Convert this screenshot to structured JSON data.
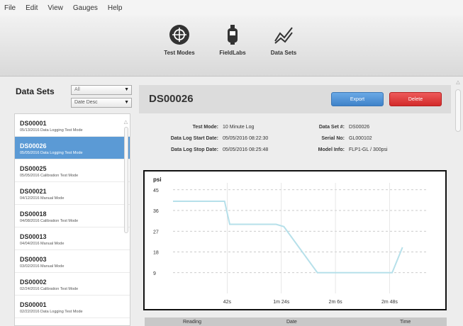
{
  "menu": [
    "File",
    "Edit",
    "View",
    "Gauges",
    "Help"
  ],
  "toolbar": {
    "test_modes": "Test Modes",
    "fieldlabs": "FieldLabs",
    "data_sets": "Data Sets"
  },
  "sidebar": {
    "title": "Data Sets",
    "filter": "All",
    "sort": "Date Desc",
    "items": [
      {
        "id": "DS00001",
        "sub": "05/13/2016   Data Logging Test Mode"
      },
      {
        "id": "DS00026",
        "sub": "05/05/2016   Data Logging Test Mode"
      },
      {
        "id": "DS00025",
        "sub": "05/05/2016   Calibration Test Mode"
      },
      {
        "id": "DS00021",
        "sub": "04/12/2016   Manual Mode"
      },
      {
        "id": "DS00018",
        "sub": "04/08/2016   Calibration Test Mode"
      },
      {
        "id": "DS00013",
        "sub": "04/04/2016   Manual Mode"
      },
      {
        "id": "DS00003",
        "sub": "03/02/2016   Manual Mode"
      },
      {
        "id": "DS00002",
        "sub": "02/24/2016   Calibration Test Mode"
      },
      {
        "id": "DS00001",
        "sub": "02/22/2016   Data Logging Test Mode"
      }
    ]
  },
  "detail": {
    "title": "DS00026",
    "export_label": "Export",
    "delete_label": "Delete",
    "test_mode_key": "Test Mode:",
    "test_mode_val": "10 Minute Log",
    "start_key": "Data Log Start Date:",
    "start_val": "05/05/2016 08:22:30",
    "stop_key": "Data Log Stop Date:",
    "stop_val": "05/05/2016 08:25:48",
    "dataset_key": "Data Set #:",
    "dataset_val": "DS00026",
    "serial_key": "Serial No:",
    "serial_val": "GL000102",
    "model_key": "Model Info:",
    "model_val": "FLP1-GL / 300psi"
  },
  "table_headers": [
    "Reading",
    "Date",
    "Time"
  ],
  "colors": {
    "selected": "#5b9ad5",
    "export": "#4a90d9",
    "delete": "#e03a3a",
    "series": "#b6e0ea"
  },
  "chart_data": {
    "type": "line",
    "ylabel": "psi",
    "yticks": [
      "45",
      "36",
      "27",
      "18",
      "9"
    ],
    "xticks": [
      "42s",
      "1m 24s",
      "2m 6s",
      "2m 48s"
    ],
    "ylim": [
      0,
      48
    ],
    "xlim": [
      0,
      198
    ],
    "grid": true,
    "series": [
      {
        "x": [
          0,
          40,
          44,
          80,
          86,
          112,
          170,
          178
        ],
        "y": [
          40,
          40,
          30,
          30,
          29,
          9,
          9,
          20
        ]
      }
    ]
  }
}
